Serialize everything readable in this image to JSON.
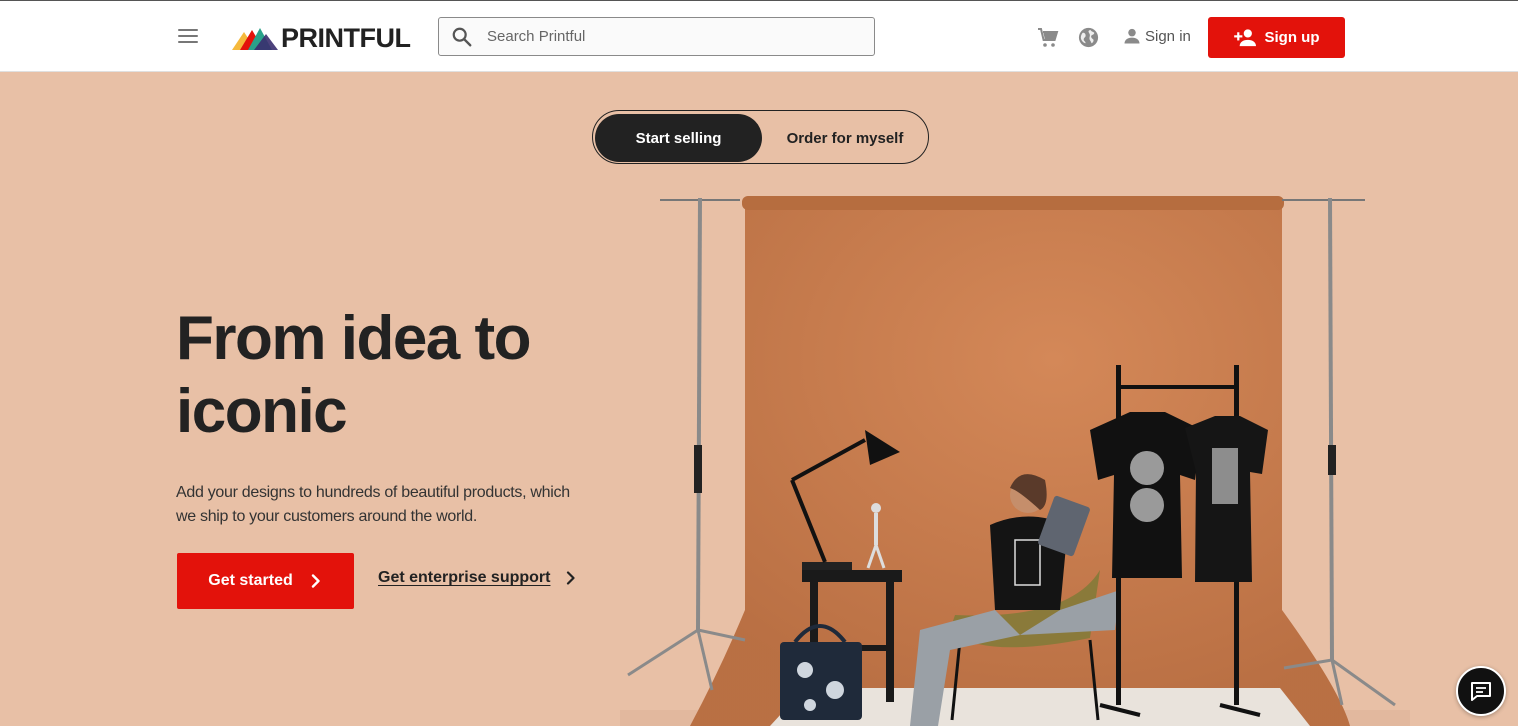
{
  "header": {
    "logo_text": "PRINTFUL",
    "search_placeholder": "Search Printful",
    "signin_label": "Sign in",
    "signup_label": "Sign up"
  },
  "toggle": {
    "active_label": "Start selling",
    "inactive_label": "Order for myself"
  },
  "hero": {
    "title_line1": "From idea to",
    "title_line2": "iconic",
    "description_line1": "Add your designs to hundreds of beautiful products, which",
    "description_line2": "we ship to your customers around the world.",
    "primary_cta": "Get started",
    "secondary_cta": "Get enterprise support"
  },
  "colors": {
    "accent": "#e3120b",
    "hero_bg": "#e8c0a6",
    "backdrop": "#c97b4b",
    "dark": "#222222"
  },
  "icons": [
    "menu-icon",
    "search-icon",
    "cart-icon",
    "globe-icon",
    "user-icon",
    "add-user-icon",
    "chevron-right-icon",
    "chat-icon"
  ]
}
